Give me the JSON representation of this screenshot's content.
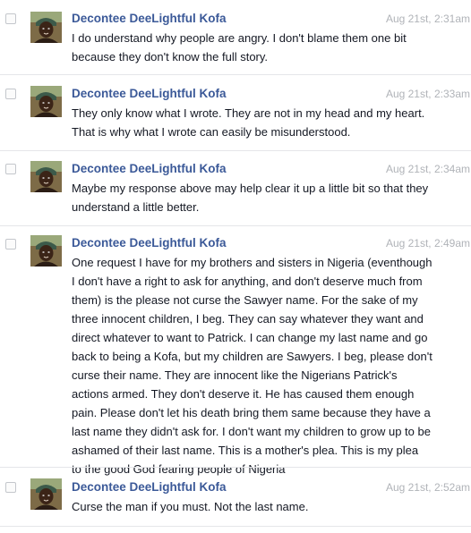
{
  "messages": [
    {
      "author": "Decontee DeeLightful Kofa",
      "timestamp": "Aug 21st, 2:31am",
      "lines": [
        "I do understand why people are angry.  I don't blame them one bit",
        "because they don't know the full story."
      ]
    },
    {
      "author": "Decontee DeeLightful Kofa",
      "timestamp": "Aug 21st, 2:33am",
      "lines": [
        "They only know what I wrote.  They are not in my head and my heart.",
        "That is why what I wrote can easily be misunderstood."
      ]
    },
    {
      "author": "Decontee DeeLightful Kofa",
      "timestamp": "Aug 21st, 2:34am",
      "lines": [
        "Maybe my response above may help clear it up a little bit so that they",
        "understand a little better."
      ]
    },
    {
      "author": "Decontee DeeLightful Kofa",
      "timestamp": "Aug 21st, 2:49am",
      "lines": [
        "One request I have for my brothers and sisters in Nigeria (eventhough",
        "I don't have a right to ask for anything, and don't deserve much from",
        "them) is the please not curse the Sawyer name.  For the sake of my",
        "three innocent children, I beg.  They can say whatever they want and",
        "direct whatever to want to Patrick.  I can change my last name and go",
        "back to being a Kofa, but my children are Sawyers.  I beg, please don't",
        "curse their name.  They are innocent like the Nigerians Patrick's",
        "actions armed.  They don't deserve it.  He has caused them enough",
        "pain.  Please don't let his death bring them same because they have a",
        "last name they didn't ask for.  I don't want my children to grow up to be",
        "ashamed of their last name.  This is a mother's plea.  This is my plea",
        "to the good God fearing people of Nigeria"
      ]
    },
    {
      "author": "Decontee DeeLightful Kofa",
      "timestamp": "Aug 21st, 2:52am",
      "lines": [
        "Curse the man if you must.  Not the last name."
      ]
    }
  ]
}
